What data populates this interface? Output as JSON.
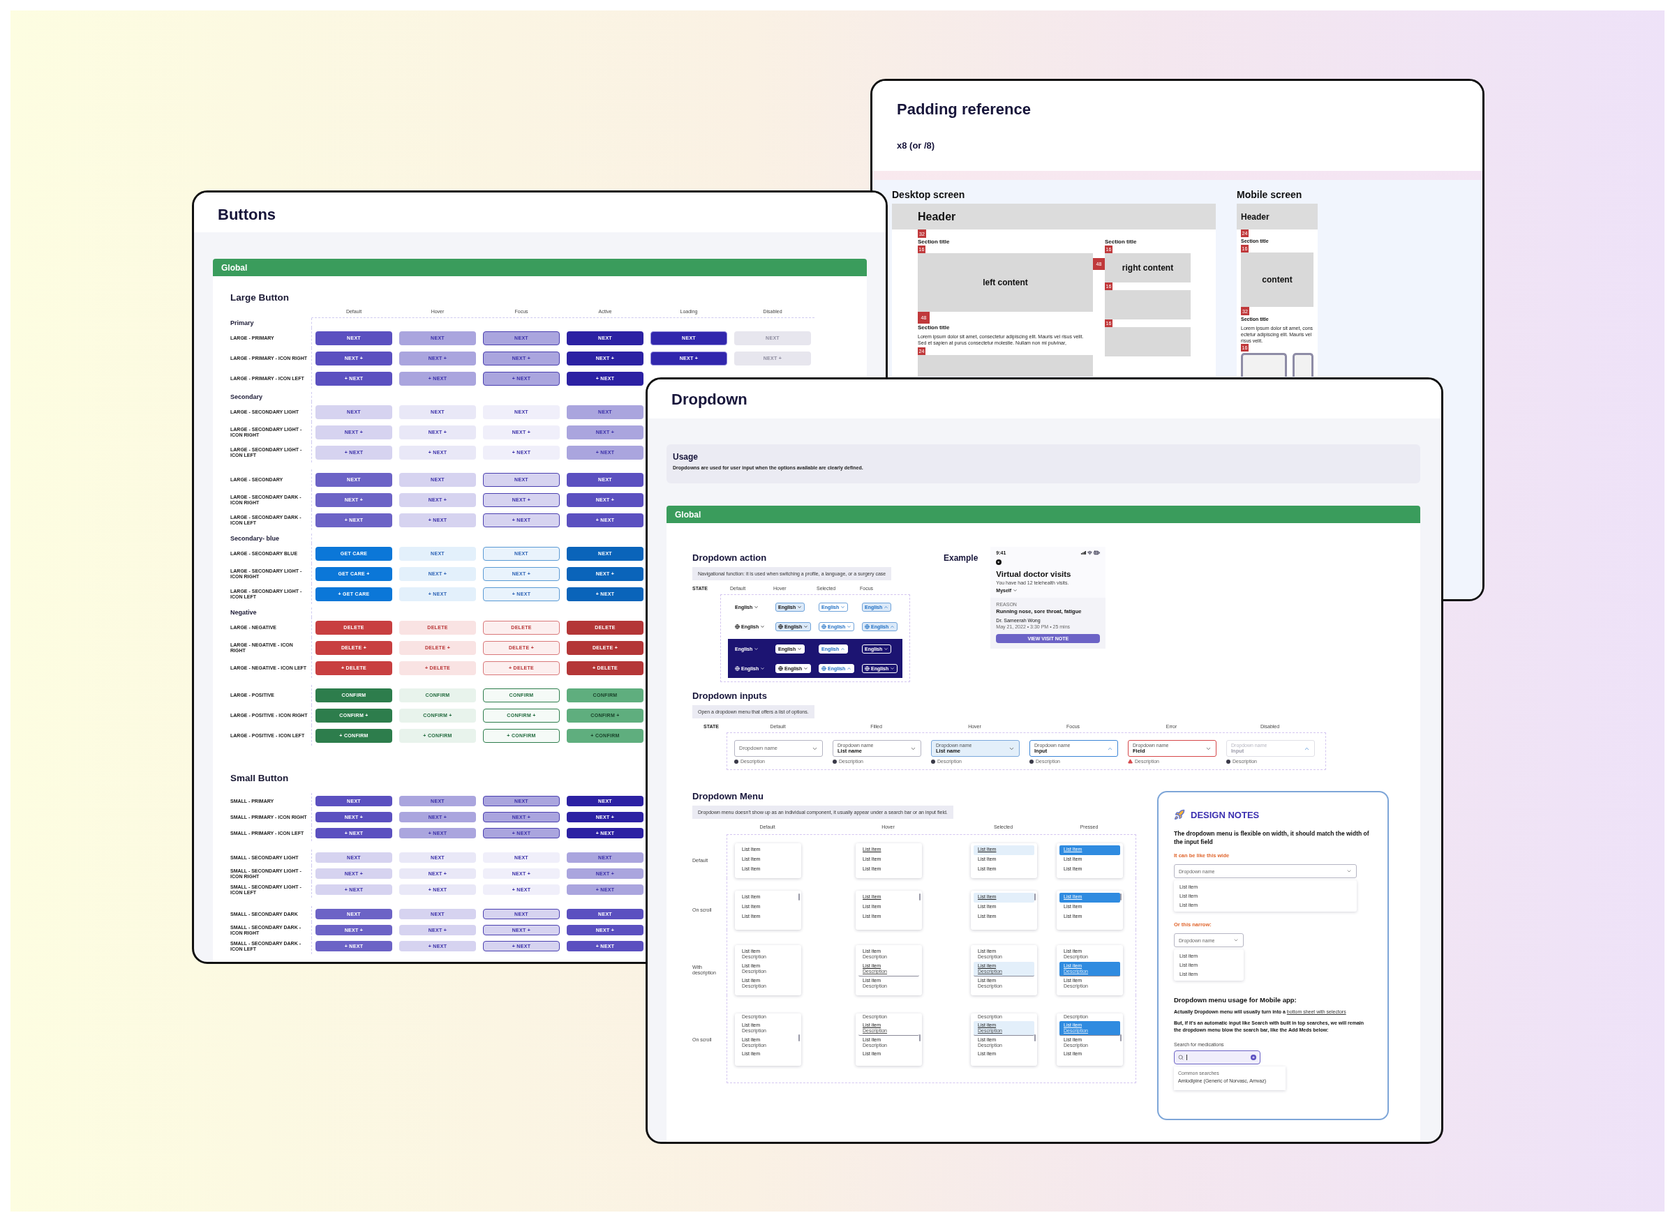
{
  "buttons_board": {
    "title": "Buttons",
    "section": "Global",
    "groups": [
      {
        "title": "Large Button",
        "kind": "large",
        "columns": [
          "Default",
          "Hover",
          "Focus",
          "Active",
          "Loading",
          "Disabled"
        ],
        "sets": [
          {
            "heading": "Primary",
            "rows": [
              {
                "label": "LARGE - PRIMARY",
                "kind": "primary",
                "cells": [
                  "NEXT",
                  "NEXT",
                  "NEXT",
                  "NEXT",
                  "NEXT",
                  "NEXT"
                ]
              },
              {
                "label": "LARGE - PRIMARY - ICON RIGHT",
                "kind": "primary",
                "cells": [
                  "NEXT +",
                  "NEXT +",
                  "NEXT +",
                  "NEXT +",
                  "NEXT +",
                  "NEXT +"
                ]
              },
              {
                "label": "LARGE - PRIMARY - ICON LEFT",
                "kind": "primary",
                "cells": [
                  "+ NEXT",
                  "+ NEXT",
                  "+ NEXT",
                  "+ NEXT"
                ]
              }
            ]
          },
          {
            "heading": "Secondary",
            "rows": [
              {
                "label": "LARGE - SECONDARY LIGHT",
                "kind": "light",
                "cells": [
                  "NEXT",
                  "NEXT",
                  "NEXT",
                  "NEXT"
                ]
              },
              {
                "label": "LARGE - SECONDARY LIGHT - ICON RIGHT",
                "kind": "light",
                "cells": [
                  "NEXT +",
                  "NEXT +",
                  "NEXT +",
                  "NEXT +"
                ]
              },
              {
                "label": "LARGE - SECONDARY LIGHT - ICON LEFT",
                "kind": "light",
                "cells": [
                  "+ NEXT",
                  "+ NEXT",
                  "+ NEXT",
                  "+ NEXT"
                ]
              }
            ]
          },
          {
            "rows": [
              {
                "label": "LARGE - SECONDARY",
                "kind": "dark",
                "cells": [
                  "NEXT",
                  "NEXT",
                  "NEXT",
                  "NEXT"
                ]
              },
              {
                "label": "LARGE - SECONDARY DARK - ICON RIGHT",
                "kind": "dark",
                "cells": [
                  "NEXT +",
                  "NEXT +",
                  "NEXT +",
                  "NEXT +"
                ]
              },
              {
                "label": "LARGE - SECONDARY DARK - ICON LEFT",
                "kind": "dark",
                "cells": [
                  "+ NEXT",
                  "+ NEXT",
                  "+ NEXT",
                  "+ NEXT"
                ]
              }
            ]
          },
          {
            "heading": "Secondary- blue",
            "rows": [
              {
                "label": "LARGE - SECONDARY BLUE",
                "kind": "blue",
                "cells": [
                  "GET CARE",
                  "NEXT",
                  "NEXT",
                  "NEXT"
                ]
              },
              {
                "label": "LARGE - SECONDARY LIGHT - ICON RIGHT",
                "kind": "blue",
                "cells": [
                  "GET CARE +",
                  "NEXT +",
                  "NEXT +",
                  "NEXT +"
                ]
              },
              {
                "label": "LARGE - SECONDARY LIGHT - ICON LEFT",
                "kind": "blue",
                "cells": [
                  "+ GET CARE",
                  "+ NEXT",
                  "+ NEXT",
                  "+ NEXT"
                ]
              }
            ]
          },
          {
            "heading": "Negative",
            "rows": [
              {
                "label": "LARGE - NEGATIVE",
                "kind": "negative",
                "cells": [
                  "DELETE",
                  "DELETE",
                  "DELETE",
                  "DELETE"
                ]
              },
              {
                "label": "LARGE - NEGATIVE - ICON RIGHT",
                "kind": "negative",
                "cells": [
                  "DELETE +",
                  "DELETE +",
                  "DELETE +",
                  "DELETE +"
                ]
              },
              {
                "label": "LARGE - NEGATIVE - ICON LEFT",
                "kind": "negative",
                "cells": [
                  "+ DELETE",
                  "+ DELETE",
                  "+ DELETE",
                  "+ DELETE"
                ]
              }
            ]
          },
          {
            "rows": [
              {
                "label": "LARGE - POSITIVE",
                "kind": "positive",
                "cells": [
                  "CONFIRM",
                  "CONFIRM",
                  "CONFIRM",
                  "CONFIRM"
                ]
              },
              {
                "label": "LARGE - POSITIVE - ICON RIGHT",
                "kind": "positive",
                "cells": [
                  "CONFIRM +",
                  "CONFIRM +",
                  "CONFIRM +",
                  "CONFIRM +"
                ]
              },
              {
                "label": "LARGE - POSITIVE - ICON LEFT",
                "kind": "positive",
                "cells": [
                  "+ CONFIRM",
                  "+ CONFIRM",
                  "+ CONFIRM",
                  "+ CONFIRM"
                ]
              }
            ]
          }
        ]
      },
      {
        "title": "Small Button",
        "kind": "small",
        "sets": [
          {
            "rows": [
              {
                "label": "SMALL - PRIMARY",
                "kind": "primary",
                "cells": [
                  "NEXT",
                  "NEXT",
                  "NEXT",
                  "NEXT"
                ]
              },
              {
                "label": "SMALL - PRIMARY - ICON RIGHT",
                "kind": "primary",
                "cells": [
                  "NEXT +",
                  "NEXT +",
                  "NEXT +",
                  "NEXT +"
                ]
              },
              {
                "label": "SMALL - PRIMARY - ICON LEFT",
                "kind": "primary",
                "cells": [
                  "+ NEXT",
                  "+ NEXT",
                  "+ NEXT",
                  "+ NEXT"
                ]
              }
            ]
          },
          {
            "rows": [
              {
                "label": "SMALL - SECONDARY LIGHT",
                "kind": "light",
                "cells": [
                  "NEXT",
                  "NEXT",
                  "NEXT",
                  "NEXT"
                ]
              },
              {
                "label": "SMALL - SECONDARY LIGHT - ICON RIGHT",
                "kind": "light",
                "cells": [
                  "NEXT +",
                  "NEXT +",
                  "NEXT +",
                  "NEXT +"
                ]
              },
              {
                "label": "SMALL - SECONDARY LIGHT - ICON LEFT",
                "kind": "light",
                "cells": [
                  "+ NEXT",
                  "+ NEXT",
                  "+ NEXT",
                  "+ NEXT"
                ]
              }
            ]
          },
          {
            "rows": [
              {
                "label": "SMALL - SECONDARY DARK",
                "kind": "dark",
                "cells": [
                  "NEXT",
                  "NEXT",
                  "NEXT",
                  "NEXT"
                ]
              },
              {
                "label": "SMALL - SECONDARY DARK - ICON RIGHT",
                "kind": "dark",
                "cells": [
                  "NEXT +",
                  "NEXT +",
                  "NEXT +",
                  "NEXT +"
                ]
              },
              {
                "label": "SMALL - SECONDARY DARK - ICON LEFT",
                "kind": "dark",
                "cells": [
                  "+ NEXT",
                  "+ NEXT",
                  "+ NEXT",
                  "+ NEXT"
                ]
              }
            ]
          }
        ]
      }
    ]
  },
  "padding_board": {
    "title": "Padding reference",
    "subtitle": "x8 (or /8)",
    "desktop": {
      "title": "Desktop screen",
      "header": "Header",
      "top_gap": "32",
      "section_title": "Section title",
      "title_gap": "16",
      "left_content": "left content",
      "column_gap": "48",
      "right_title": "Section title",
      "right_gaps": [
        "16",
        "16",
        "16"
      ],
      "right_content": "right content",
      "block_gap": "48",
      "second_title": "Section title",
      "paragraph": "Lorem ipsum dolor sit amet, consectetur adipiscing elit. Mauris vel risus velit. Sed et sapien at purus consectetur molestie. Nullam non mi pulvinar,",
      "paragraph_gap": "24"
    },
    "mobile": {
      "title": "Mobile screen",
      "header": "Header",
      "top_gap": "24",
      "section_title": "Section title",
      "title_gap": "16",
      "content": "content",
      "block_gap": "32",
      "second_title": "Section title",
      "paragraph": "Lorem ipsum dolor sit amet, cons ectetur adipiscing elit. Mauris vel risus velit.",
      "paragraph_gap": "16"
    }
  },
  "dropdown_board": {
    "title": "Dropdown",
    "usage": {
      "title": "Usage",
      "text": "Dropdowns are used for user input when the options available are clearly defined."
    },
    "section": "Global",
    "action": {
      "title": "Dropdown action",
      "note": "Navigational function: it is used when switching a profile, a language, or a surgery case",
      "state_label": "STATE",
      "columns": [
        "Default",
        "Hover",
        "Selected",
        "Focus"
      ],
      "rows": [
        {
          "kind": "light",
          "globe": false,
          "cells": [
            "English",
            "English",
            "English",
            "English"
          ]
        },
        {
          "kind": "light",
          "globe": true,
          "cells": [
            "English",
            "English",
            "English",
            "English"
          ]
        },
        {
          "kind": "dark",
          "globe": false,
          "cells": [
            "English",
            "English",
            "English",
            "English"
          ]
        },
        {
          "kind": "dark",
          "globe": true,
          "cells": [
            "English",
            "English",
            "English",
            "English"
          ]
        }
      ]
    },
    "example": {
      "title": "Example",
      "time": "9:41",
      "heading": "Virtual doctor visits",
      "subtext": "You have had 12 telehealth visits.",
      "filter": "Myself",
      "reason_label": "REASON",
      "reason": "Running nose, sore throat, fatigue",
      "doctor": "Dr. Sameerah Wong",
      "meta": "May 21, 2022 • 3:30 PM • 25 mins",
      "button": "VIEW VISIT NOTE"
    },
    "inputs": {
      "title": "Dropdown inputs",
      "note": "Open a dropdown menu that offers a list of options.",
      "state_label": "STATE",
      "columns": [
        "Default",
        "Filled",
        "Hover",
        "Focus",
        "Error",
        "Disabled"
      ],
      "fields": [
        {
          "kind": "default",
          "placeholder": "Dropdown name",
          "description": "Description"
        },
        {
          "kind": "filled",
          "label": "Dropdown name",
          "value": "List name",
          "description": "Description"
        },
        {
          "kind": "hover",
          "label": "Dropdown name",
          "value": "List name",
          "description": "Description"
        },
        {
          "kind": "focus",
          "label": "Dropdown name",
          "value": "Input",
          "description": "Description"
        },
        {
          "kind": "error",
          "label": "Dropdown name",
          "value": "Field",
          "description": "Description"
        },
        {
          "kind": "disabled",
          "label": "Dropdown name",
          "value": "Input",
          "description": "Description"
        }
      ]
    },
    "menus": {
      "title": "Dropdown Menu",
      "note": "Dropdown menu doesn't show up as an individual component, it usually appear under a search bar or an input field.",
      "columns": [
        "Default",
        "Hover",
        "Selected",
        "Pressed"
      ],
      "rows": [
        {
          "label": "Default",
          "kind": "plain",
          "scroll": false,
          "menus": [
            {
              "kind": "default",
              "items": [
                {
                  "title": "List Item",
                  "selected": false
                },
                {
                  "title": "List Item",
                  "selected": false
                },
                {
                  "title": "List Item",
                  "selected": false
                }
              ]
            },
            {
              "kind": "hover",
              "items": [
                {
                  "title": "List Item",
                  "selected": true
                },
                {
                  "title": "List Item",
                  "selected": false
                },
                {
                  "title": "List Item",
                  "selected": false
                }
              ]
            },
            {
              "kind": "selected",
              "items": [
                {
                  "title": "List Item",
                  "selected": true
                },
                {
                  "title": "List Item",
                  "selected": false
                },
                {
                  "title": "List Item",
                  "selected": false
                }
              ]
            },
            {
              "kind": "pressed",
              "items": [
                {
                  "title": "List Item",
                  "selected": true
                },
                {
                  "title": "List Item",
                  "selected": false
                },
                {
                  "title": "List Item",
                  "selected": false
                }
              ]
            }
          ]
        },
        {
          "label": "On scroll",
          "kind": "plain",
          "scroll": true,
          "menus": [
            {
              "kind": "default",
              "items": [
                {
                  "title": "List Item",
                  "selected": false
                },
                {
                  "title": "List Item",
                  "selected": false
                },
                {
                  "title": "List Item",
                  "selected": false
                }
              ]
            },
            {
              "kind": "hover",
              "items": [
                {
                  "title": "List Item",
                  "selected": true
                },
                {
                  "title": "List Item",
                  "selected": false
                },
                {
                  "title": "List Item",
                  "selected": false
                }
              ]
            },
            {
              "kind": "selected",
              "items": [
                {
                  "title": "List Item",
                  "selected": true
                },
                {
                  "title": "List Item",
                  "selected": false
                },
                {
                  "title": "List Item",
                  "selected": false
                }
              ]
            },
            {
              "kind": "pressed",
              "items": [
                {
                  "title": "List Item",
                  "selected": true
                },
                {
                  "title": "List Item",
                  "selected": false
                },
                {
                  "title": "List Item",
                  "selected": false
                }
              ]
            }
          ]
        },
        {
          "label": "With description",
          "kind": "described",
          "scroll": false,
          "menus": [
            {
              "kind": "default",
              "items": [
                {
                  "title": "List item",
                  "description": "Description",
                  "selected": false
                },
                {
                  "title": "List item",
                  "description": "Description",
                  "selected": false
                },
                {
                  "title": "List item",
                  "description": "Description",
                  "selected": false
                }
              ]
            },
            {
              "kind": "hover",
              "items": [
                {
                  "title": "List item",
                  "description": "Description",
                  "selected": false
                },
                {
                  "title": "List item",
                  "description": "Description",
                  "selected": true
                },
                {
                  "title": "List item",
                  "description": "Description",
                  "selected": false
                }
              ]
            },
            {
              "kind": "selected",
              "items": [
                {
                  "title": "List item",
                  "description": "Description",
                  "selected": false
                },
                {
                  "title": "List item",
                  "description": "Description",
                  "selected": true
                },
                {
                  "title": "List item",
                  "description": "Description",
                  "selected": false
                }
              ]
            },
            {
              "kind": "pressed",
              "items": [
                {
                  "title": "List item",
                  "description": "Description",
                  "selected": false
                },
                {
                  "title": "List item",
                  "description": "Description",
                  "selected": true
                },
                {
                  "title": "List item",
                  "description": "Description",
                  "selected": false
                }
              ]
            }
          ]
        },
        {
          "label": "On scroll",
          "kind": "described",
          "scroll": true,
          "menus": [
            {
              "kind": "default",
              "items": [
                {
                  "description": "Description",
                  "selected": false
                },
                {
                  "title": "List item",
                  "description": "Description",
                  "selected": false
                },
                {
                  "title": "List item",
                  "description": "Description",
                  "selected": false
                },
                {
                  "title": "List item",
                  "selected": false
                }
              ]
            },
            {
              "kind": "hover",
              "items": [
                {
                  "description": "Description",
                  "selected": false
                },
                {
                  "title": "List item",
                  "description": "Description",
                  "selected": true
                },
                {
                  "title": "List item",
                  "description": "Description",
                  "selected": false
                },
                {
                  "title": "List item",
                  "selected": false
                }
              ]
            },
            {
              "kind": "selected",
              "items": [
                {
                  "description": "Description",
                  "selected": false
                },
                {
                  "title": "List item",
                  "description": "Description",
                  "selected": true
                },
                {
                  "title": "List item",
                  "description": "Description",
                  "selected": false
                },
                {
                  "title": "List item",
                  "selected": false
                }
              ]
            },
            {
              "kind": "pressed",
              "items": [
                {
                  "description": "Description",
                  "selected": false
                },
                {
                  "title": "List item",
                  "description": "Description",
                  "selected": true
                },
                {
                  "title": "List item",
                  "description": "Description",
                  "selected": false
                },
                {
                  "title": "List item",
                  "selected": false
                }
              ]
            }
          ]
        }
      ]
    },
    "design_notes": {
      "title": "DESIGN NOTES",
      "lead": "The dropdown menu is flexible on width, it should match the width of the input field",
      "wide_label": "It can be like this wide",
      "wide_field": "Dropdown name",
      "wide_items": [
        "List item",
        "List item",
        "List item"
      ],
      "narrow_label": "Or this narrow:",
      "narrow_field": "Dropdown name",
      "narrow_items": [
        "List item",
        "List item",
        "List item"
      ],
      "mobile_title": "Dropdown menu usage for Mobile app:",
      "mobile_text": "Actually Dropdown menu will usually turn into a",
      "mobile_link": "bottom sheet with selectors",
      "mobile_text_2": "But, if it's an automatic input like Search with built in top searches, we will remain the dropdown menu blow the search bar, like the Add Meds below:",
      "search_label": "Search for medications",
      "suggestions_label": "Common searches",
      "suggestion": "Amlodipine (Generic of Norvasc, Amvaz)"
    }
  }
}
